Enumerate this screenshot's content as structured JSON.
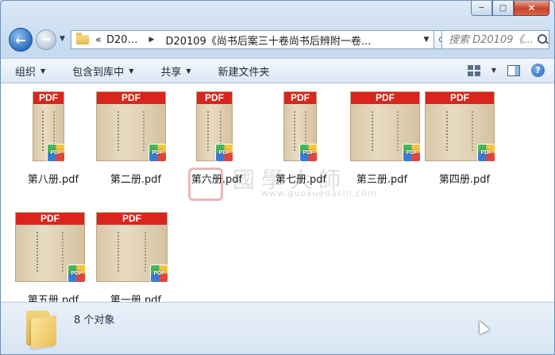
{
  "window": {
    "caption": {
      "minimize": "─",
      "maximize": "□",
      "close": "✕"
    }
  },
  "address": {
    "back_glyph": "←",
    "forward_glyph": "→",
    "crumbs": [
      "«",
      "D20…",
      "D20109《尚书后案三十卷尚书后辨附一卷..."
    ],
    "search_placeholder": "搜索 D20109《..."
  },
  "toolbar": {
    "organize": "组织",
    "include_library": "包含到库中",
    "share": "共享",
    "new_folder": "新建文件夹"
  },
  "files": [
    {
      "name": "第八册.pdf",
      "badge": "PDF"
    },
    {
      "name": "第二册.pdf",
      "badge": "PDF"
    },
    {
      "name": "第六册.pdf",
      "badge": "PDF"
    },
    {
      "name": "第七册.pdf",
      "badge": "PDF"
    },
    {
      "name": "第三册.pdf",
      "badge": "PDF"
    },
    {
      "name": "第四册.pdf",
      "badge": "PDF"
    },
    {
      "name": "第五册.pdf",
      "badge": "PDF"
    },
    {
      "name": "第一册.pdf",
      "badge": "PDF"
    }
  ],
  "thumb_label": "PDF",
  "watermark": {
    "text": "國學大師",
    "url": "www.guoxuedashi.com"
  },
  "status": {
    "count": "8 个对象"
  },
  "colors": {
    "pdf_red": "#d9251d",
    "window_blue": "#c6daf0",
    "selection": "#3a7bd5"
  }
}
